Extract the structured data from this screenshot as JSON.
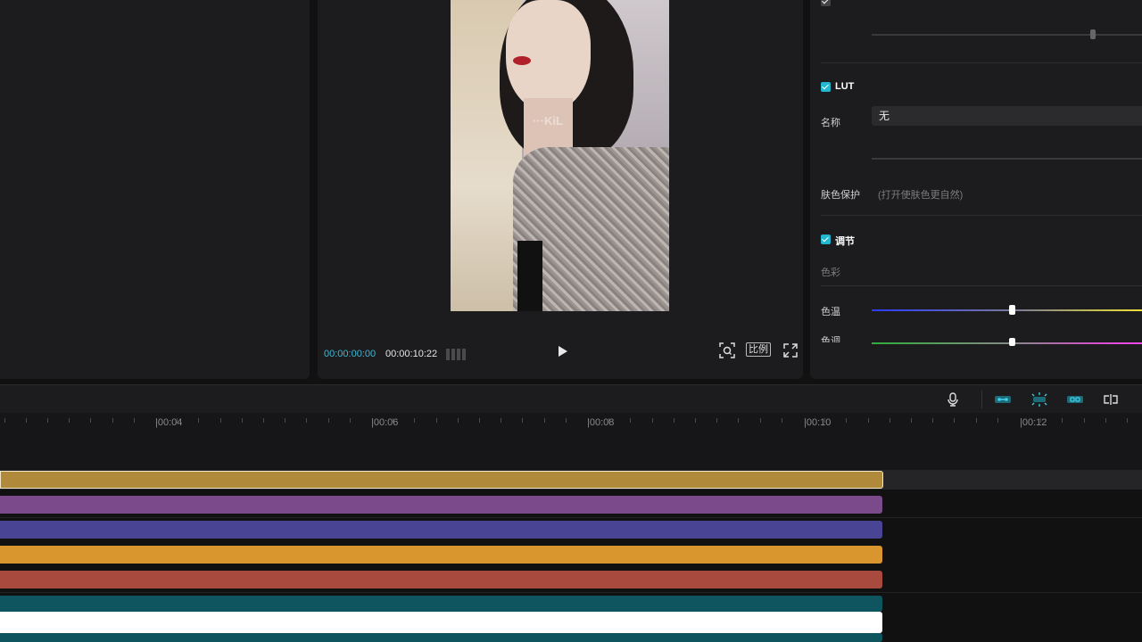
{
  "preview": {
    "current_time": "00:00:00:00",
    "total_time": "00:00:10:22",
    "ratio_label": "比例",
    "watermark": "···KiL"
  },
  "inspector": {
    "lut": {
      "title": "LUT",
      "name_label": "名称",
      "name_value": "无"
    },
    "skin": {
      "label": "肤色保护",
      "hint": "(打开使肤色更自然)"
    },
    "adjust": {
      "title": "调节",
      "color_label": "色彩",
      "temp_label": "色温",
      "tint_label": "色调",
      "temp_value": 0.49,
      "tint_value": 0.49
    }
  },
  "timeline": {
    "ticks": [
      "|00:04",
      "|00:06",
      "|00:08",
      "|00:10",
      "|00:12"
    ]
  },
  "colors": {
    "accent": "#21b7cf",
    "clip_gold": "#b08a3a",
    "clip_purple": "#7a4a8a",
    "clip_indigo": "#4a4494",
    "clip_orange": "#d9952e",
    "clip_red": "#a84a3e",
    "clip_teal": "#0f5560"
  }
}
